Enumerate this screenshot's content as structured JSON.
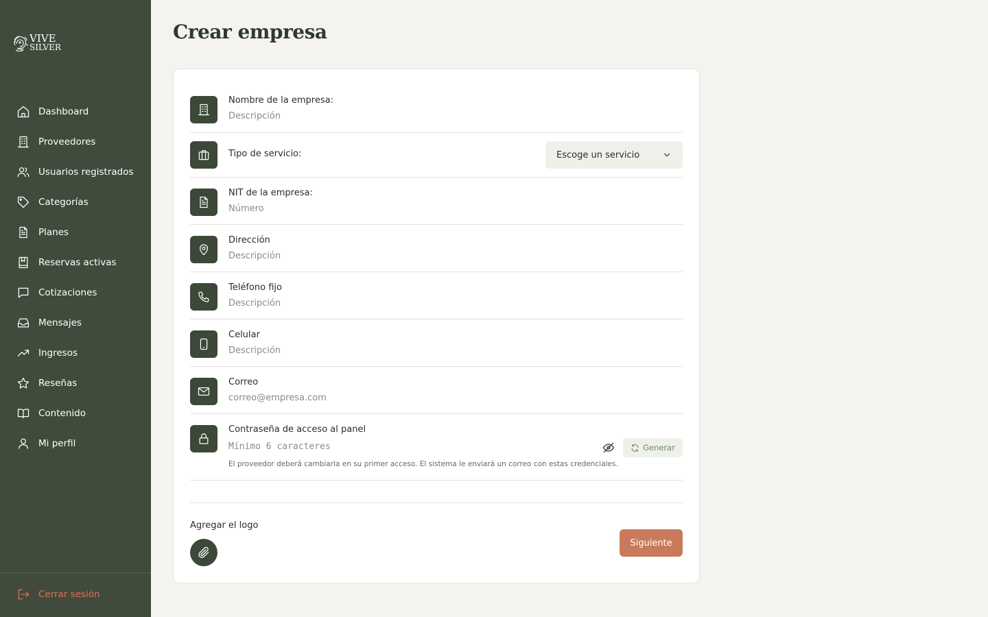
{
  "brand": {
    "line1": "VIVE",
    "line2": "SILVER"
  },
  "page": {
    "title": "Crear empresa"
  },
  "sidebar": {
    "items": [
      {
        "label": "Dashboard",
        "icon": "home-icon"
      },
      {
        "label": "Proveedores",
        "icon": "building-icon"
      },
      {
        "label": "Usuarios registrados",
        "icon": "users-icon"
      },
      {
        "label": "Categorías",
        "icon": "tag-icon"
      },
      {
        "label": "Planes",
        "icon": "document-icon"
      },
      {
        "label": "Reservas activas",
        "icon": "book-bookmark-icon"
      },
      {
        "label": "Cotizaciones",
        "icon": "chat-bubble-icon"
      },
      {
        "label": "Mensajes",
        "icon": "inbox-icon"
      },
      {
        "label": "Ingresos",
        "icon": "trending-up-icon"
      },
      {
        "label": "Reseñas",
        "icon": "star-icon"
      },
      {
        "label": "Contenido",
        "icon": "open-book-icon"
      },
      {
        "label": "Mi perfil",
        "icon": "user-icon"
      }
    ],
    "logout": "Cerrar sesión"
  },
  "form": {
    "name": {
      "label": "Nombre de la empresa:",
      "placeholder": "Descripción"
    },
    "service": {
      "label": "Tipo de servicio:",
      "selected": "Escoge un servicio"
    },
    "nit": {
      "label": "NIT de la empresa:",
      "placeholder": "Número"
    },
    "address": {
      "label": "Dirección",
      "placeholder": "Descripción"
    },
    "landline": {
      "label": "Teléfono fijo",
      "placeholder": "Descripción"
    },
    "mobile": {
      "label": "Celular",
      "placeholder": "Descripción"
    },
    "email": {
      "label": "Correo",
      "placeholder": "correo@empresa.com"
    },
    "password": {
      "label": "Contraseña de acceso al panel",
      "placeholder": "Mínimo 6 caracteres",
      "generate": "Generar",
      "hint": "El proveedor deberá cambiarla en su primer acceso. El sistema le enviará un correo con estas credenciales."
    },
    "logo": {
      "label": "Agregar el logo"
    },
    "next": "Siguiente"
  },
  "colors": {
    "sidebar": "#404b3b",
    "icon_box": "#3c4838",
    "accent": "#c97a5b",
    "logout": "#e0705a",
    "background": "#f4f3ef"
  }
}
